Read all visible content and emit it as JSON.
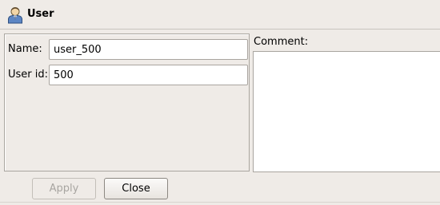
{
  "header": {
    "title": "User",
    "icon": "user-icon"
  },
  "form": {
    "name_label": "Name:",
    "name_value": "user_500",
    "userid_label": "User id:",
    "userid_value": "500"
  },
  "comment": {
    "label": "Comment:",
    "value": ""
  },
  "buttons": {
    "apply_label": "Apply",
    "close_label": "Close"
  }
}
